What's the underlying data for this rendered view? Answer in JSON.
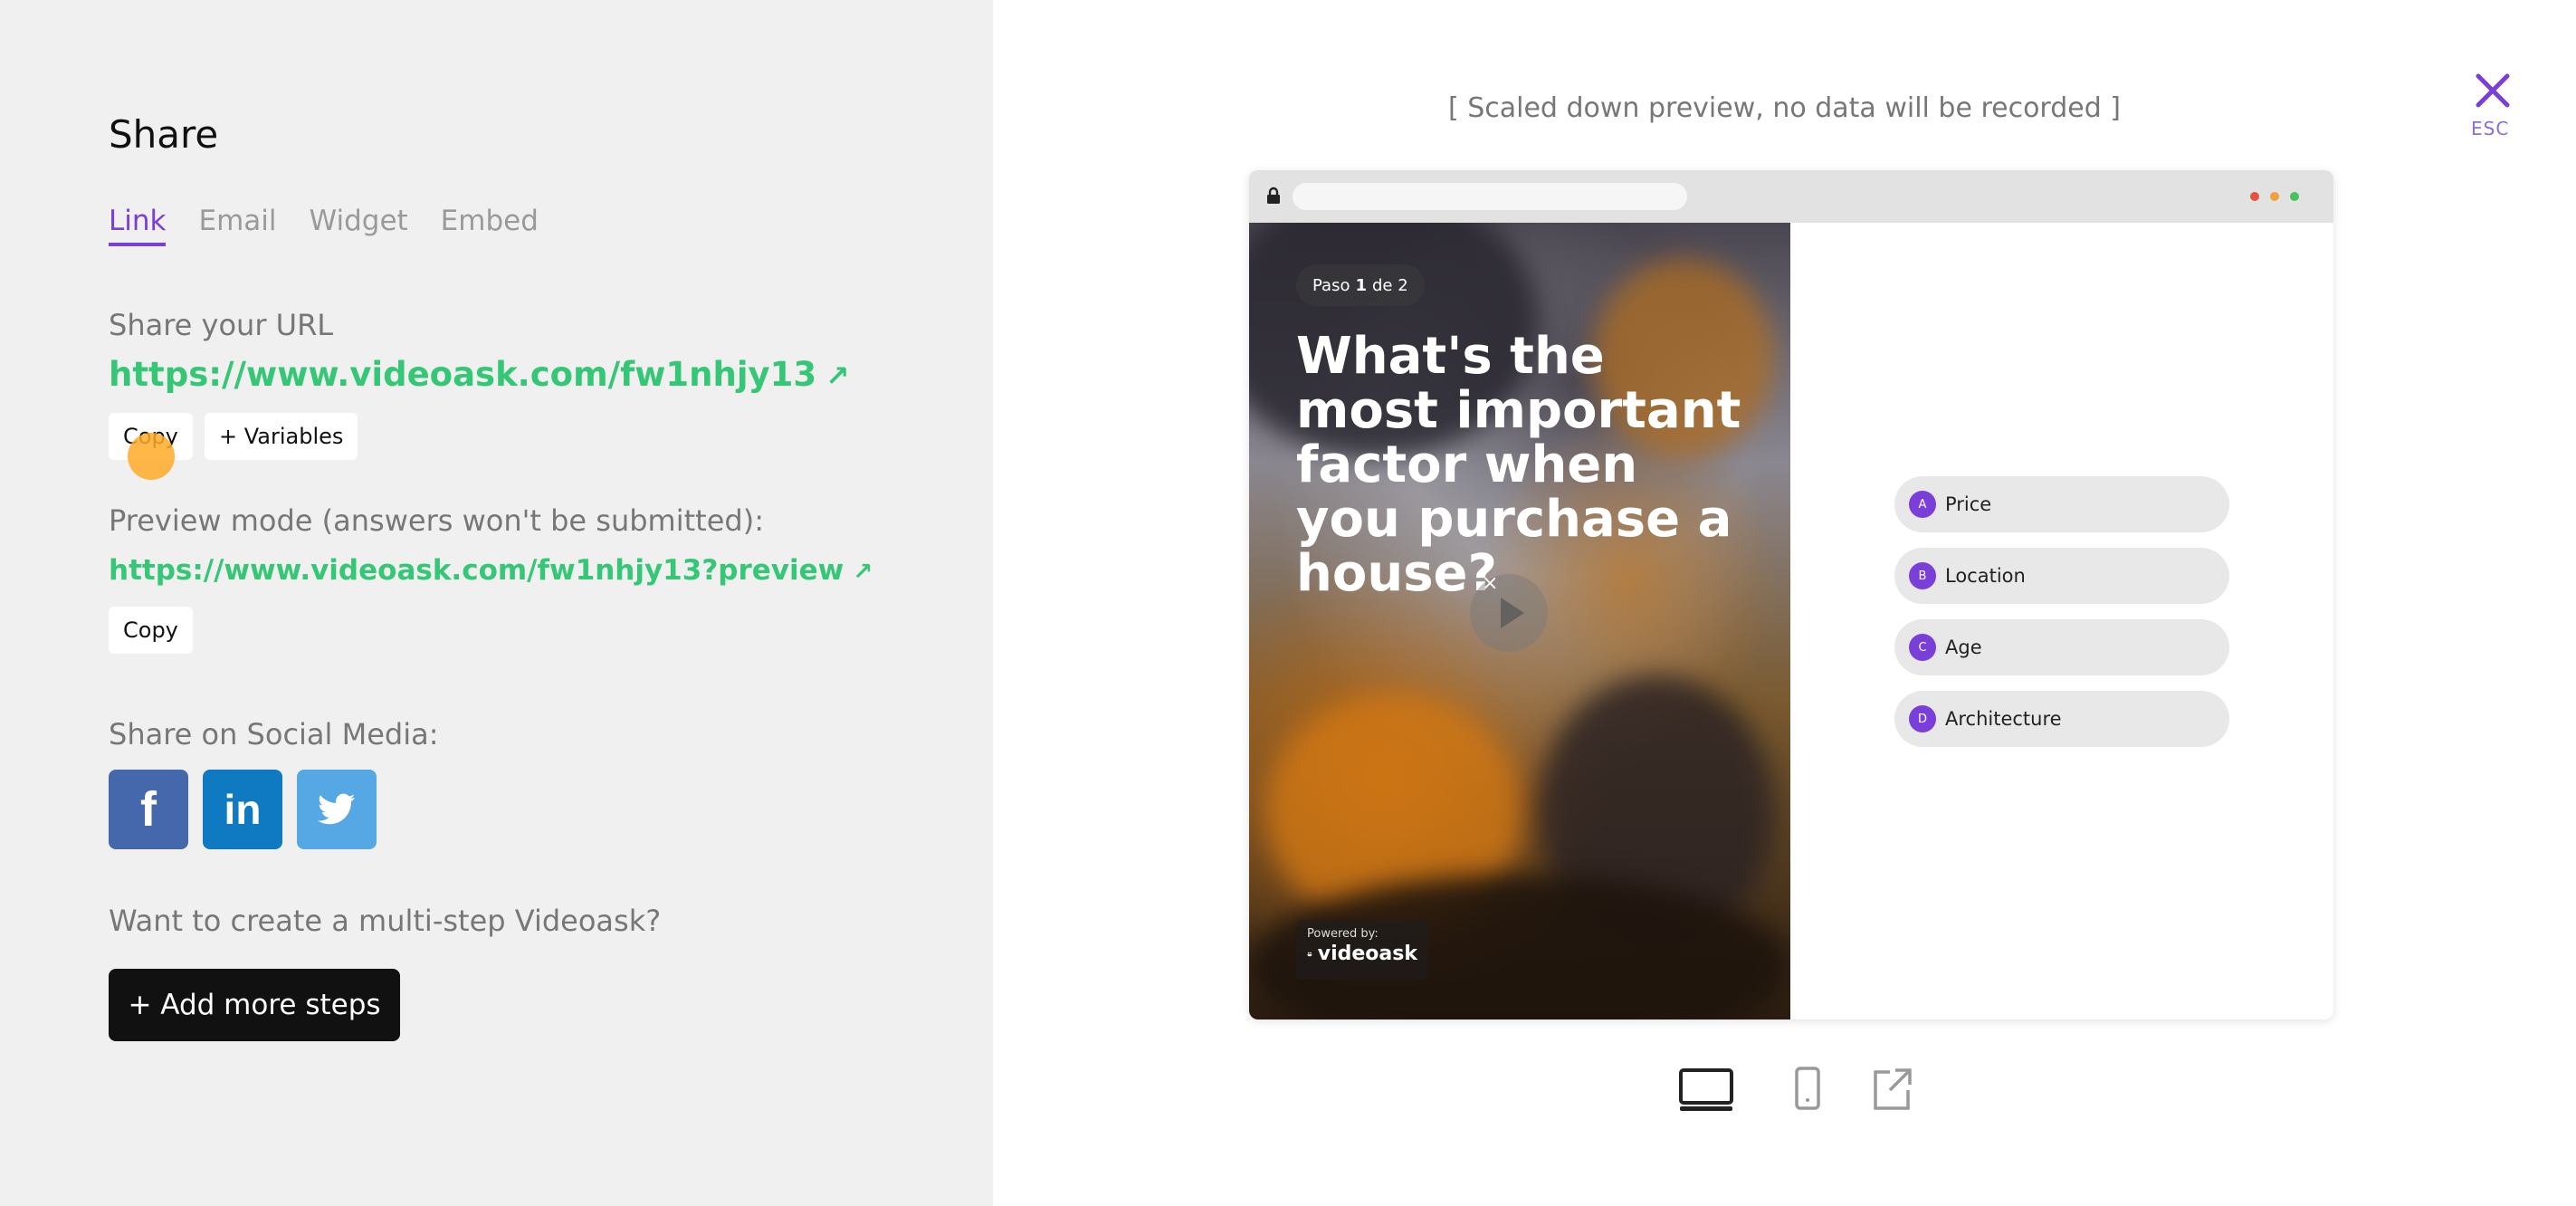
{
  "left": {
    "title": "Share",
    "tabs": [
      {
        "label": "Link",
        "active": true
      },
      {
        "label": "Email",
        "active": false
      },
      {
        "label": "Widget",
        "active": false
      },
      {
        "label": "Embed",
        "active": false
      }
    ],
    "share_url_label": "Share your URL",
    "share_url": "https://www.videoask.com/fw1nhjy13",
    "copy_label": "Copy",
    "variables_label": "+ Variables",
    "preview_label": "Preview mode (answers won't be submitted):",
    "preview_url": "https://www.videoask.com/fw1nhjy13?preview",
    "copy2_label": "Copy",
    "social_label": "Share on Social Media:",
    "social": {
      "facebook": "f",
      "linkedin": "in"
    },
    "multistep_label": "Want to create a multi-step Videoask?",
    "add_steps_label": "+ Add more steps"
  },
  "right": {
    "preview_note": "[ Scaled down preview, no data will be recorded ]",
    "esc_label": "ESC",
    "video": {
      "step_prefix": "Paso",
      "step_current": "1",
      "step_suffix": "de 2",
      "question": "What's the most important factor when you purchase a house?",
      "close_glyph": "×",
      "powered_by": "Powered by:",
      "brand": "videoask"
    },
    "options": [
      {
        "letter": "A",
        "text": "Price"
      },
      {
        "letter": "B",
        "text": "Location"
      },
      {
        "letter": "C",
        "text": "Age"
      },
      {
        "letter": "D",
        "text": "Architecture"
      }
    ]
  },
  "colors": {
    "accent": "#7a3fd9",
    "link": "#35c776",
    "facebook": "#4568ad",
    "linkedin": "#0f7ac2",
    "twitter": "#55a8e3"
  },
  "icons": [
    "arrow-up-right-icon",
    "facebook-icon",
    "linkedin-icon",
    "twitter-icon",
    "close-icon",
    "lock-icon",
    "play-icon",
    "desktop-icon",
    "mobile-icon",
    "external-link-icon"
  ]
}
